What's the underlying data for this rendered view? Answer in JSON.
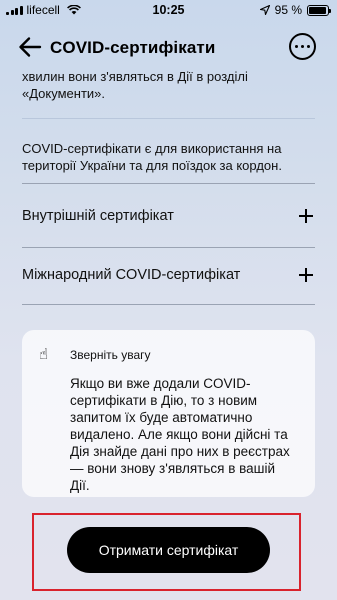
{
  "status_bar": {
    "carrier": "lifecell",
    "time": "10:25",
    "battery_text": "95 %",
    "battery_level": 0.95,
    "icons": [
      "signal-icon",
      "wifi-icon",
      "location-arrow-icon",
      "battery-icon"
    ]
  },
  "header": {
    "title": "COVID-сертифікати",
    "back_icon": "arrow-left-icon",
    "more_icon": "more-horizontal-circle-icon"
  },
  "content": {
    "intro_text": "хвилин вони з'являться в Дії в розділі «Документи».",
    "info_text": "COVID-сертифікати є для використання на території України та для поїздок за кордон.",
    "accordions": [
      {
        "label": "Внутрішній сертифікат",
        "icon": "plus-icon"
      },
      {
        "label": "Міжнародний COVID-сертифікат",
        "icon": "plus-icon"
      }
    ],
    "notice": {
      "icon": "pointing-up-hand-icon",
      "icon_glyph": "☝",
      "title": "Зверніть увагу",
      "text": "Якщо ви вже додали COVID-сертифікати в Дію, то з новим запитом їх буде автоматично видалено. Але якщо вони дійсні та Дія знайде дані про них в реєстрах — вони знову з'являться в вашій Дії."
    }
  },
  "cta": {
    "label": "Отримати сертифікат",
    "highlight_color": "#d9232d"
  },
  "colors": {
    "background_top": "#c9d8ec",
    "background_bottom": "#e2e3ee",
    "button": "#000000",
    "button_text": "#ffffff"
  }
}
